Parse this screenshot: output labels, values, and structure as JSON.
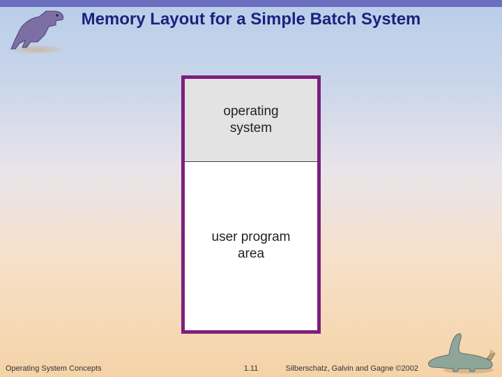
{
  "title": "Memory Layout for a Simple Batch System",
  "diagram": {
    "segments": {
      "os_line1": "operating",
      "os_line2": "system",
      "user_line1": "user program",
      "user_line2": "area"
    }
  },
  "footer": {
    "left": "Operating System Concepts",
    "center": "1.11",
    "right": "Silberschatz, Galvin and Gagne ©2002"
  },
  "decor": {
    "dino_top_left": "trex-dinosaur-icon",
    "dino_bottom_right": "sauropod-dinosaur-icon"
  },
  "colors": {
    "title": "#1a237e",
    "border": "#7d1f7c",
    "os_fill": "#e3e3e3"
  }
}
